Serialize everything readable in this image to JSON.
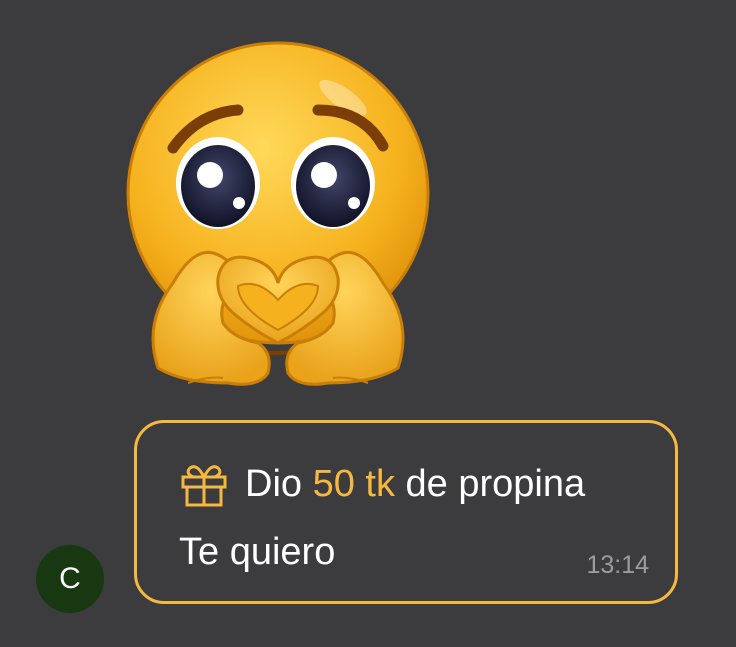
{
  "sticker": {
    "emoji": "pleading-face-heart-hands-sticker"
  },
  "avatar": {
    "initial": "C",
    "color": "#173810"
  },
  "tip_message": {
    "prefix": "Dio",
    "amount": "50 tk",
    "suffix": "de propina",
    "text": "Te quiero",
    "time": "13:14",
    "icon": "gift-icon",
    "accent_color": "#f5b841"
  }
}
